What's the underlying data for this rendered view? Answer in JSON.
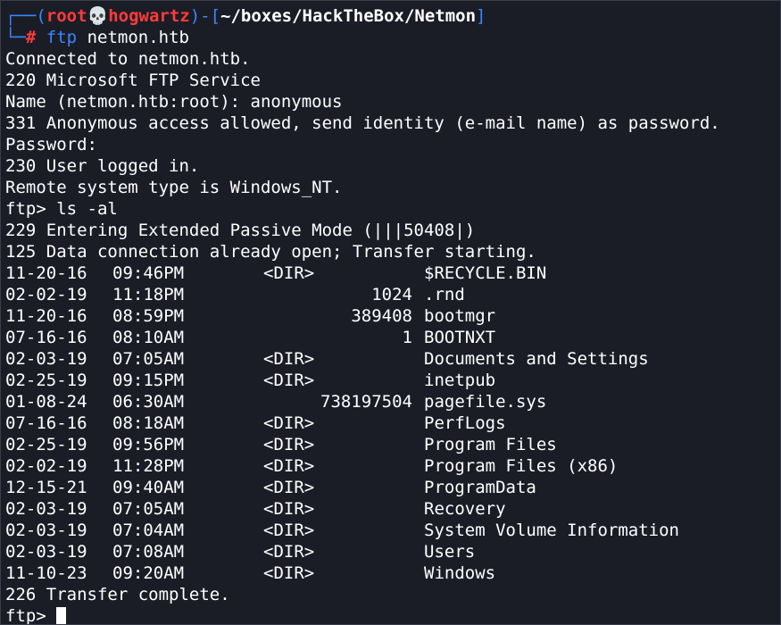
{
  "prompt": {
    "open_bracket": "┌──(",
    "user": "root",
    "skull": "💀",
    "host": "hogwartz",
    "mid": ")-[",
    "path": "~/boxes/HackTheBox/Netmon",
    "close_bracket": "]",
    "second_prefix": "└─",
    "hash": "#",
    "command": "ftp",
    "argument": " netmon.htb"
  },
  "session_lines": [
    "Connected to netmon.htb.",
    "220 Microsoft FTP Service",
    "Name (netmon.htb:root): anonymous",
    "331 Anonymous access allowed, send identity (e-mail name) as password.",
    "Password:",
    "230 User logged in.",
    "Remote system type is Windows_NT.",
    "ftp> ls -al",
    "229 Entering Extended Passive Mode (|||50408|)",
    "125 Data connection already open; Transfer starting."
  ],
  "listing": [
    {
      "date": "11-20-16",
      "time": "09:46PM",
      "dir": "<DIR>",
      "size": "",
      "name": "$RECYCLE.BIN"
    },
    {
      "date": "02-02-19",
      "time": "11:18PM",
      "dir": "",
      "size": "1024",
      "name": ".rnd"
    },
    {
      "date": "11-20-16",
      "time": "08:59PM",
      "dir": "",
      "size": "389408",
      "name": "bootmgr"
    },
    {
      "date": "07-16-16",
      "time": "08:10AM",
      "dir": "",
      "size": "1",
      "name": "BOOTNXT"
    },
    {
      "date": "02-03-19",
      "time": "07:05AM",
      "dir": "<DIR>",
      "size": "",
      "name": "Documents and Settings"
    },
    {
      "date": "02-25-19",
      "time": "09:15PM",
      "dir": "<DIR>",
      "size": "",
      "name": "inetpub"
    },
    {
      "date": "01-08-24",
      "time": "06:30AM",
      "dir": "",
      "size": "738197504",
      "name": "pagefile.sys"
    },
    {
      "date": "07-16-16",
      "time": "08:18AM",
      "dir": "<DIR>",
      "size": "",
      "name": "PerfLogs"
    },
    {
      "date": "02-25-19",
      "time": "09:56PM",
      "dir": "<DIR>",
      "size": "",
      "name": "Program Files"
    },
    {
      "date": "02-02-19",
      "time": "11:28PM",
      "dir": "<DIR>",
      "size": "",
      "name": "Program Files (x86)"
    },
    {
      "date": "12-15-21",
      "time": "09:40AM",
      "dir": "<DIR>",
      "size": "",
      "name": "ProgramData"
    },
    {
      "date": "02-03-19",
      "time": "07:05AM",
      "dir": "<DIR>",
      "size": "",
      "name": "Recovery"
    },
    {
      "date": "02-03-19",
      "time": "07:04AM",
      "dir": "<DIR>",
      "size": "",
      "name": "System Volume Information"
    },
    {
      "date": "02-03-19",
      "time": "07:08AM",
      "dir": "<DIR>",
      "size": "",
      "name": "Users"
    },
    {
      "date": "11-10-23",
      "time": "09:20AM",
      "dir": "<DIR>",
      "size": "",
      "name": "Windows"
    }
  ],
  "transfer_complete": "226 Transfer complete.",
  "final_prompt": "ftp> ",
  "colors": {
    "background": "#1b1d26",
    "prompt_frame": "#3a86ff",
    "prompt_user": "#ff3b3b",
    "text": "#ffffff"
  }
}
